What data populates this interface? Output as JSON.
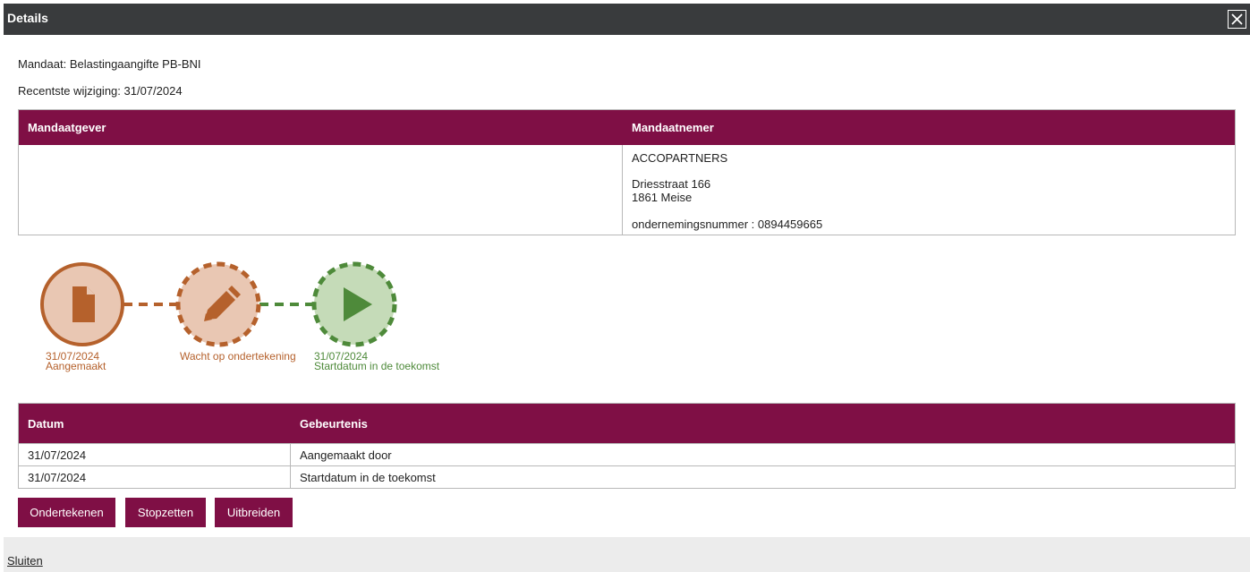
{
  "window": {
    "title": "Details",
    "close_icon": "close-icon"
  },
  "info": {
    "mandate": "Mandaat: Belastingaangifte PB-BNI",
    "last_change": "Recentste wijziging: 31/07/2024"
  },
  "parties": {
    "headers": [
      "Mandaatgever",
      "Mandaatnemer"
    ],
    "mandatee": {
      "name": "ACCOPARTNERS",
      "street": "Driesstraat 166",
      "city": "1861 Meise",
      "company_number": "ondernemingsnummer : 0894459665"
    }
  },
  "timeline": {
    "steps": [
      {
        "date": "31/07/2024",
        "label": "Aangemaakt",
        "icon": "document-icon",
        "status": "done",
        "color": "#b5612c"
      },
      {
        "date": "",
        "label": "Wacht op ondertekening",
        "icon": "pencil-icon",
        "status": "pending",
        "color": "#b5612c"
      },
      {
        "date": "31/07/2024",
        "label": "Startdatum in de toekomst",
        "icon": "play-icon",
        "status": "future",
        "color": "#4e8a3a"
      }
    ]
  },
  "history": {
    "headers": [
      "Datum",
      "Gebeurtenis"
    ],
    "rows": [
      {
        "date": "31/07/2024",
        "event": "Aangemaakt door"
      },
      {
        "date": "31/07/2024",
        "event": "Startdatum in de toekomst"
      }
    ]
  },
  "actions": {
    "sign": "Ondertekenen",
    "stop": "Stopzetten",
    "extend": "Uitbreiden"
  },
  "footer": {
    "close_link": "Sluiten"
  },
  "colors": {
    "header_bar": "#393b3d",
    "accent": "#7f0f45",
    "orange": "#b5612c",
    "green": "#4e8a3a"
  }
}
